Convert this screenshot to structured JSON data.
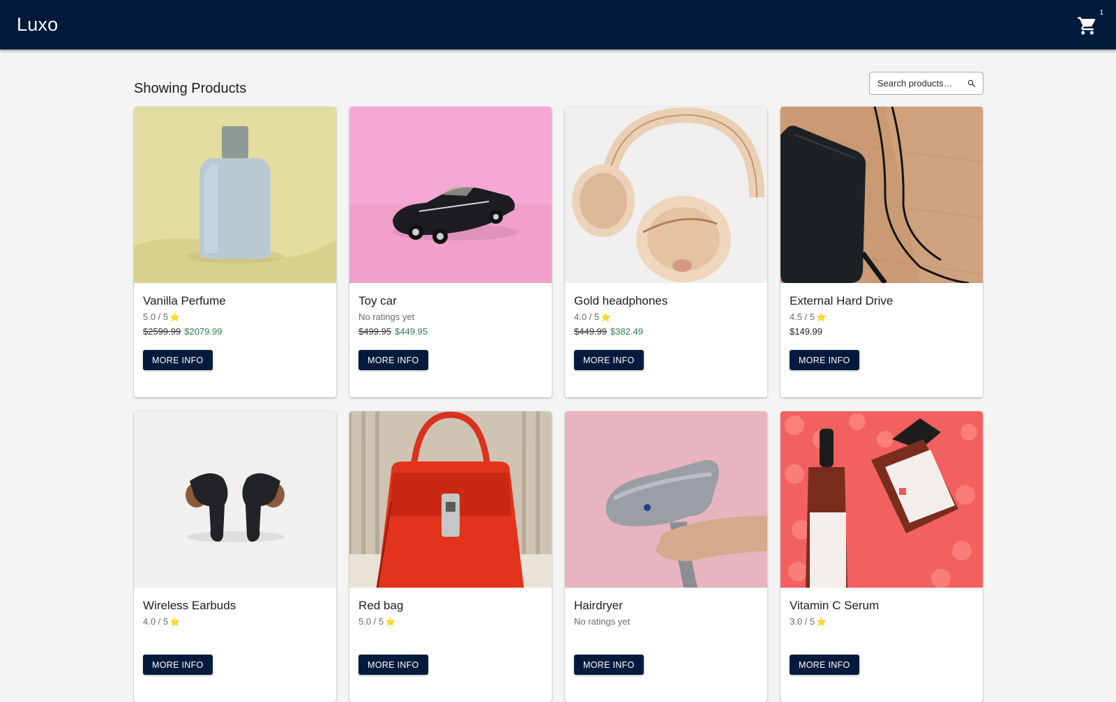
{
  "app": {
    "title": "Luxo"
  },
  "header": {
    "cart_icon": "shopping-cart-icon",
    "cart_count": "1"
  },
  "main": {
    "heading": "Showing Products",
    "search": {
      "placeholder": "Search products…",
      "value": "",
      "icon": "search-icon"
    }
  },
  "colors": {
    "brand": "#021b3c",
    "sale_price": "#2e7d55",
    "star": "#f2c037"
  },
  "products": [
    {
      "name": "Vanilla Perfume",
      "rating": "5.0 / 5",
      "star": "⭐",
      "old_price": "$2599.99",
      "price": "$2079.99",
      "button": "MORE INFO",
      "image": "perfume-bottle-image"
    },
    {
      "name": "Toy car",
      "rating": "No ratings yet",
      "star": "",
      "old_price": "$499.95",
      "price": "$449.95",
      "button": "MORE INFO",
      "image": "toy-car-image"
    },
    {
      "name": "Gold headphones",
      "rating": "4.0 / 5",
      "star": "⭐",
      "old_price": "$449.99",
      "price": "$382.49",
      "button": "MORE INFO",
      "image": "headphones-image"
    },
    {
      "name": "External Hard Drive",
      "rating": "4.5 / 5",
      "star": "⭐",
      "old_price": "",
      "price": "$149.99",
      "button": "MORE INFO",
      "image": "hard-drive-image"
    },
    {
      "name": "Wireless Earbuds",
      "rating": "4.0 / 5",
      "star": "⭐",
      "old_price": "",
      "price": "",
      "button": "MORE INFO",
      "image": "earbuds-image"
    },
    {
      "name": "Red bag",
      "rating": "5.0 / 5",
      "star": "⭐",
      "old_price": "",
      "price": "",
      "button": "MORE INFO",
      "image": "red-bag-image"
    },
    {
      "name": "Hairdryer",
      "rating": "No ratings yet",
      "star": "",
      "old_price": "",
      "price": "",
      "button": "MORE INFO",
      "image": "hairdryer-image"
    },
    {
      "name": "Vitamin C Serum",
      "rating": "3.0 / 5",
      "star": "⭐",
      "old_price": "",
      "price": "",
      "button": "MORE INFO",
      "image": "serum-bottles-image"
    }
  ]
}
